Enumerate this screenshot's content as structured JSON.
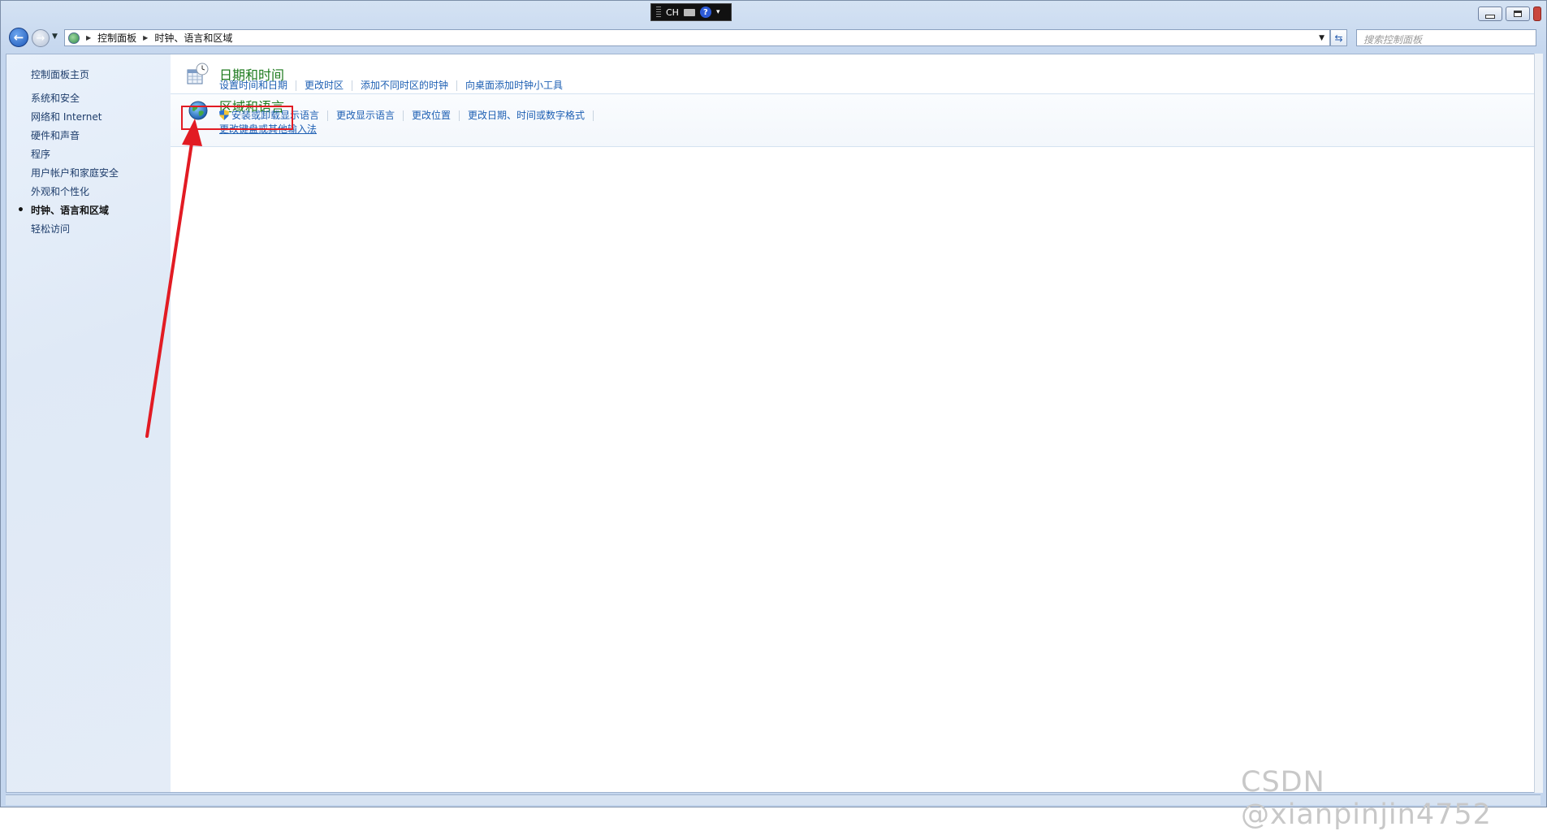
{
  "titlebar": {
    "lang_indicator": "CH",
    "help_glyph": "?",
    "controls": {
      "minimize": "minimize-icon",
      "maximize": "maximize-icon",
      "close": "close-icon"
    }
  },
  "navigation": {
    "back_glyph": "←",
    "forward_glyph": "→",
    "breadcrumb": [
      "控制面板",
      "时钟、语言和区域"
    ],
    "search_placeholder": "搜索控制面板"
  },
  "sidebar": {
    "home": "控制面板主页",
    "items": [
      {
        "label": "系统和安全",
        "active": false
      },
      {
        "label": "网络和 Internet",
        "active": false
      },
      {
        "label": "硬件和声音",
        "active": false
      },
      {
        "label": "程序",
        "active": false
      },
      {
        "label": "用户帐户和家庭安全",
        "active": false
      },
      {
        "label": "外观和个性化",
        "active": false
      },
      {
        "label": "时钟、语言和区域",
        "active": true
      },
      {
        "label": "轻松访问",
        "active": false
      }
    ]
  },
  "main": {
    "categories": [
      {
        "title": "日期和时间",
        "icon": "calendar-clock-icon",
        "links": [
          "设置时间和日期",
          "更改时区",
          "添加不同时区的时钟",
          "向桌面添加时钟小工具"
        ]
      },
      {
        "title": "区域和语言",
        "icon": "globe-icon",
        "links": [
          "安装或卸载显示语言",
          "更改显示语言",
          "更改位置",
          "更改日期、时间或数字格式"
        ],
        "links_row2": [
          "更改键盘或其他输入法"
        ]
      }
    ]
  },
  "annotation": {
    "highlight_color": "#e21b23",
    "arrow_color": "#e21b23"
  },
  "watermark": "CSDN @xianpinjin4752",
  "colors": {
    "link": "#1d5fb3",
    "category_title": "#1d7a1d",
    "sidebar_bg": "#e4ecf7"
  }
}
